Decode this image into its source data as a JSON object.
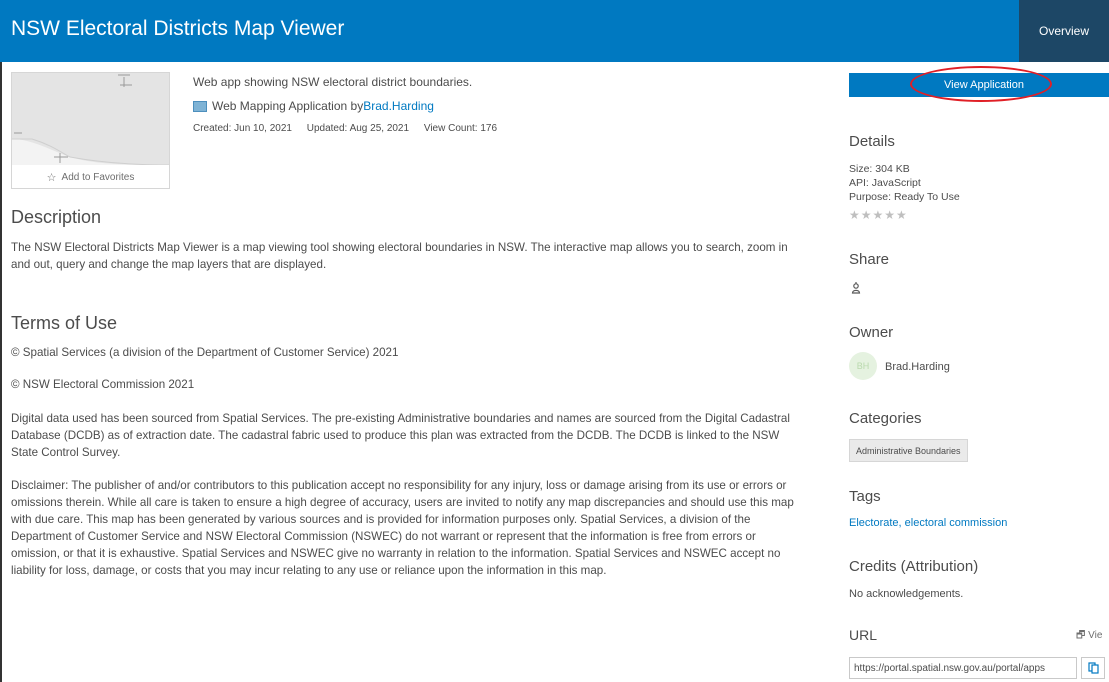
{
  "header": {
    "title": "NSW Electoral Districts Map Viewer",
    "overview_label": "Overview"
  },
  "item": {
    "summary": "Web app showing NSW electoral district boundaries.",
    "type_label": "Web Mapping Application by ",
    "owner_link": "Brad.Harding",
    "created": "Created: Jun 10, 2021",
    "updated": "Updated: Aug 25, 2021",
    "view_count": "View Count: 176",
    "add_favorites": "Add to Favorites"
  },
  "description": {
    "heading": "Description",
    "text": "The NSW Electoral Districts Map Viewer is a map viewing tool showing electoral boundaries in NSW. The interactive map allows you to search, zoom in and out, query and change the map layers that are displayed."
  },
  "terms": {
    "heading": "Terms of Use",
    "p1": "© Spatial Services (a division of the Department of Customer Service) 2021",
    "p2": "© NSW Electoral Commission 2021",
    "p3": "Digital data used has been sourced from Spatial Services. The pre-existing Administrative boundaries and names are sourced from the Digital Cadastral Database (DCDB) as of extraction date. The cadastral fabric used to produce this plan was extracted from the DCDB. The DCDB is linked to the NSW State Control Survey.",
    "p4": "Disclaimer: The publisher of and/or contributors to this publication accept no responsibility for any injury, loss or damage arising from its use or errors or omissions therein. While all care is taken to ensure a high degree of accuracy, users are invited to notify any map discrepancies and should use this map with due care. This map has been generated by various sources and is provided for information purposes only. Spatial Services, a division of the Department of Customer Service and NSW Electoral Commission (NSWEC) do not warrant or represent that the information is free from errors or omission, or that it is exhaustive. Spatial Services and NSWEC give no warranty in relation to the information. Spatial Services and NSWEC accept no liability for loss, damage, or costs that you may incur relating to any use or reliance upon the information in this map."
  },
  "sidebar": {
    "view_button": "View Application",
    "details": {
      "heading": "Details",
      "size": "Size: 304 KB",
      "api": "API: JavaScript",
      "purpose": "Purpose: Ready To Use",
      "stars": "★★★★★",
      "rating": 0
    },
    "share_heading": "Share",
    "owner": {
      "heading": "Owner",
      "initials": "BH",
      "name": "Brad.Harding"
    },
    "categories": {
      "heading": "Categories",
      "items": [
        "Administrative Boundaries"
      ]
    },
    "tags": {
      "heading": "Tags",
      "text": "Electorate, electoral commission"
    },
    "credits": {
      "heading": "Credits (Attribution)",
      "text": "No acknowledgements."
    },
    "url": {
      "heading": "URL",
      "view_link": "Vie",
      "value": "https://portal.spatial.nsw.gov.au/portal/apps"
    }
  },
  "colors": {
    "header_bg": "#0079c1",
    "overview_bg": "#1d4766",
    "link": "#0079c1",
    "highlight": "#e01f26"
  },
  "icons": {
    "favorite": "star-outline-icon",
    "share": "share-icon",
    "copy": "copy-icon",
    "external": "external-link-icon"
  }
}
